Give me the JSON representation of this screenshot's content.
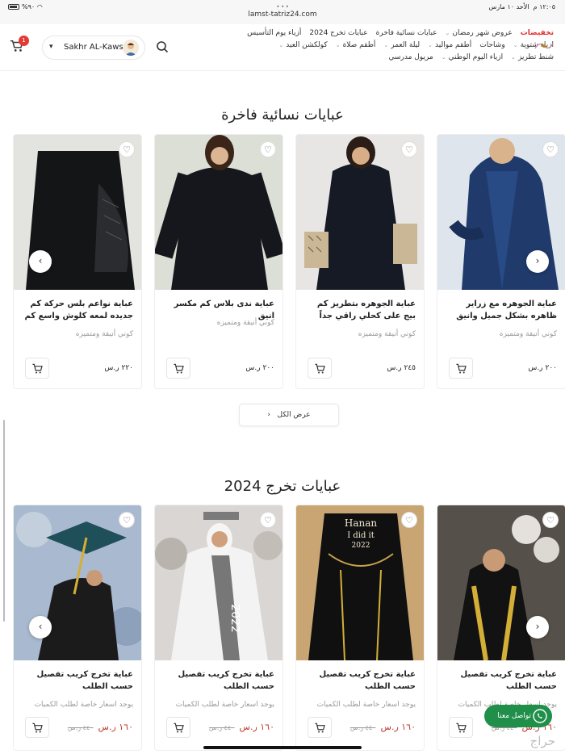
{
  "status_bar": {
    "time": "١٢:٠٥ م",
    "date": "الأحد ١٠ مارس",
    "battery": "%٩٠",
    "url": "lamst-tatriz24.com"
  },
  "header": {
    "user_name": "Sakhr AL-Kawsi",
    "cart_count": "1",
    "nav_rows": [
      [
        {
          "label": "تخفيضات",
          "sale": true,
          "dropdown": false
        },
        {
          "label": "عروض شهر رمضان",
          "sale": false,
          "dropdown": true
        },
        {
          "label": "عبايات نسائية فاخرة",
          "sale": false,
          "dropdown": false
        },
        {
          "label": "عبايات تخرج 2024",
          "sale": false,
          "dropdown": false
        },
        {
          "label": "أزياء يوم التأسيس",
          "sale": false,
          "dropdown": false
        }
      ],
      [
        {
          "label": "ازياء شتوية",
          "sale": false,
          "dropdown": true
        },
        {
          "label": "وشاحات",
          "sale": false,
          "dropdown": false
        },
        {
          "label": "أطقم مواليد",
          "sale": false,
          "dropdown": true
        },
        {
          "label": "ليلة العمر",
          "sale": false,
          "dropdown": true
        },
        {
          "label": "أطقم صلاة",
          "sale": false,
          "dropdown": true
        },
        {
          "label": "كولكشن العيد",
          "sale": false,
          "dropdown": true
        }
      ],
      [
        {
          "label": "شنط تطريز",
          "sale": false,
          "dropdown": true
        },
        {
          "label": "ازياء اليوم الوطني",
          "sale": false,
          "dropdown": true
        },
        {
          "label": "مريول مدرسي",
          "sale": false,
          "dropdown": false
        }
      ]
    ]
  },
  "sections": [
    {
      "title": "عبايات نسائية فاخرة",
      "products": [
        {
          "title": "عباية الجوهره مع زراير ظاهره بشكل جميل وانيق",
          "subtitle": "كوني أنيقة ومتميزه",
          "price": "٢٠٠ ر.س",
          "old_price": "",
          "image": "navy-abaya"
        },
        {
          "title": "عباية الجوهره بتطريز كم بيج على كحلي راقي جداً",
          "subtitle": "كوني أنيقة ومتميزه",
          "price": "٢٤٥ ر.س",
          "old_price": "",
          "image": "black-embroidered-abaya"
        },
        {
          "title": "عباية ندى بلاس كم مكسر انيق",
          "subtitle": "كوني أنيقة ومتميزه",
          "price": "٢٠٠ ر.س",
          "old_price": "",
          "image": "black-abaya"
        },
        {
          "title": "عباية نواعم بلس حركة كم جديده لمعه كلوش واسع كم",
          "subtitle": "كوني أنيقة ومتميزه",
          "price": "٢٢٠ ر.س",
          "old_price": "",
          "image": "black-lace-abaya"
        }
      ]
    },
    {
      "title": "عبايات تخرج 2024",
      "products": [
        {
          "title": "عباية تخرج كريب تفصيل حسب الطلب",
          "subtitle": "يوجد اسعار خاصة لطلب الكميات",
          "price": "١٦٠ ر.س",
          "old_price": "٤٤٠ ر.س",
          "image": "graduation-black-gold"
        },
        {
          "title": "عباية تخرج كريب تفصيل حسب الطلب",
          "subtitle": "يوجد اسعار خاصة لطلب الكميات",
          "price": "١٦٠ ر.س",
          "old_price": "٤٤٠ ر.س",
          "image": "graduation-hanan"
        },
        {
          "title": "عباية تخرج كريب تفصيل حسب الطلب",
          "subtitle": "يوجد اسعار خاصة لطلب الكميات",
          "price": "١٦٠ ر.س",
          "old_price": "٤٤٠ ر.س",
          "image": "graduation-white-sash"
        },
        {
          "title": "عباية تخرج كريب تفصيل حسب الطلب",
          "subtitle": "يوجد اسعار خاصة لطلب الكميات",
          "price": "١٦٠ ر.س",
          "old_price": "٤٤٠ ر.س",
          "image": "graduation-teal-cap"
        }
      ]
    }
  ],
  "view_all_label": "عرض الكل",
  "whatsapp_label": "تواصل معنا",
  "watermark_text": "حراج",
  "graduation_cap_texts": {
    "hanan": "Hanan",
    "did_it": "I did it",
    "year": "2022",
    "sash_year": "2022"
  },
  "colors": {
    "sale": "#e23030",
    "price_new": "#c0392b",
    "whatsapp": "#1f8f4a",
    "badge": "#e53935"
  }
}
